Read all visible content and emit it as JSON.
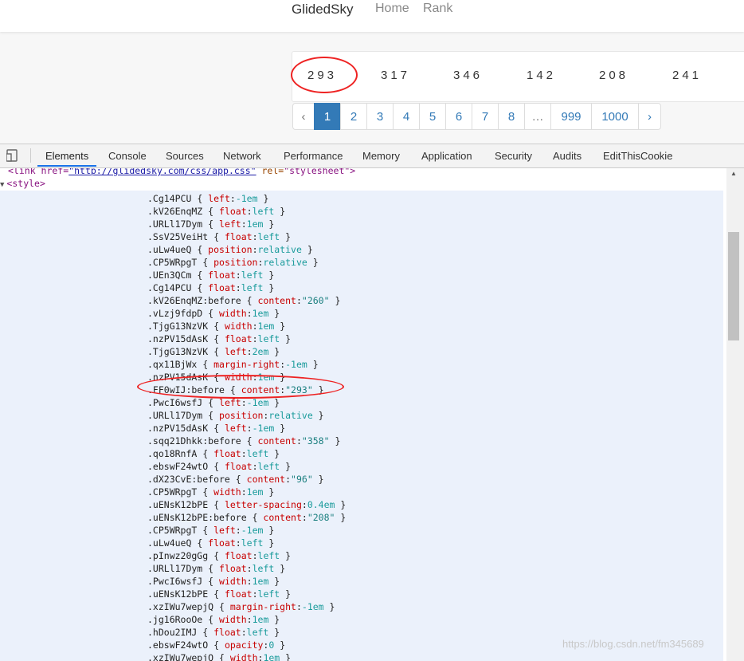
{
  "header": {
    "brand": "GlidedSky",
    "nav": [
      "Home",
      "Rank"
    ]
  },
  "numbers": [
    "293",
    "317",
    "346",
    "142",
    "208",
    "241"
  ],
  "pagination": [
    "‹",
    "1",
    "2",
    "3",
    "4",
    "5",
    "6",
    "7",
    "8",
    "…",
    "999",
    "1000",
    "›"
  ],
  "pagination_active": "1",
  "devtools": {
    "tabs": [
      "Elements",
      "Console",
      "Sources",
      "Network",
      "Performance",
      "Memory",
      "Application",
      "Security",
      "Audits",
      "EditThisCookie"
    ],
    "active_tab": "Elements",
    "link_line": {
      "tag_open": "<link href=",
      "href": "\"http://glidedsky.com/css/app.css\"",
      "rel_attr": " rel=",
      "rel_val": "\"stylesheet\"",
      "tag_close": ">"
    },
    "style_tag": "<style>",
    "rules": [
      {
        "sel": ".Cg14PCU",
        "prop": "left",
        "val": "-1em"
      },
      {
        "sel": ".kV26EnqMZ",
        "prop": "float",
        "val": "left"
      },
      {
        "sel": ".URLl17Dym",
        "prop": "left",
        "val": "1em"
      },
      {
        "sel": ".SsV25VeiHt",
        "prop": "float",
        "val": "left"
      },
      {
        "sel": ".uLw4ueQ",
        "prop": "position",
        "val": "relative"
      },
      {
        "sel": ".CP5WRpgT",
        "prop": "position",
        "val": "relative"
      },
      {
        "sel": ".UEn3QCm",
        "prop": "float",
        "val": "left"
      },
      {
        "sel": ".Cg14PCU",
        "prop": "float",
        "val": "left"
      },
      {
        "sel": ".kV26EnqMZ:before",
        "prop": "content",
        "val": "\"260\""
      },
      {
        "sel": ".vLzj9fdpD",
        "prop": "width",
        "val": "1em"
      },
      {
        "sel": ".TjgG13NzVK",
        "prop": "width",
        "val": "1em"
      },
      {
        "sel": ".nzPV15dAsK",
        "prop": "float",
        "val": "left"
      },
      {
        "sel": ".TjgG13NzVK",
        "prop": "left",
        "val": "2em"
      },
      {
        "sel": ".qx11BjWx",
        "prop": "margin-right",
        "val": "-1em"
      },
      {
        "sel": ".nzPV15dAsK",
        "prop": "width",
        "val": "1em"
      },
      {
        "sel": ".FF0wIJ:before",
        "prop": "content",
        "val": "\"293\""
      },
      {
        "sel": ".PwcI6wsfJ",
        "prop": "left",
        "val": "-1em"
      },
      {
        "sel": ".URLl17Dym",
        "prop": "position",
        "val": "relative"
      },
      {
        "sel": ".nzPV15dAsK",
        "prop": "left",
        "val": "-1em"
      },
      {
        "sel": ".sqq21Dhkk:before",
        "prop": "content",
        "val": "\"358\""
      },
      {
        "sel": ".qo18RnfA",
        "prop": "float",
        "val": "left"
      },
      {
        "sel": ".ebswF24wtO",
        "prop": "float",
        "val": "left"
      },
      {
        "sel": ".dX23CvE:before",
        "prop": "content",
        "val": "\"96\""
      },
      {
        "sel": ".CP5WRpgT",
        "prop": "width",
        "val": "1em"
      },
      {
        "sel": ".uENsK12bPE",
        "prop": "letter-spacing",
        "val": "0.4em"
      },
      {
        "sel": ".uENsK12bPE:before",
        "prop": "content",
        "val": "\"208\""
      },
      {
        "sel": ".CP5WRpgT",
        "prop": "left",
        "val": "-1em"
      },
      {
        "sel": ".uLw4ueQ",
        "prop": "float",
        "val": "left"
      },
      {
        "sel": ".pInwz20gGg",
        "prop": "float",
        "val": "left"
      },
      {
        "sel": ".URLl17Dym",
        "prop": "float",
        "val": "left"
      },
      {
        "sel": ".PwcI6wsfJ",
        "prop": "width",
        "val": "1em"
      },
      {
        "sel": ".uENsK12bPE",
        "prop": "float",
        "val": "left"
      },
      {
        "sel": ".xzIWu7wepjQ",
        "prop": "margin-right",
        "val": "-1em"
      },
      {
        "sel": ".jg16RooOe",
        "prop": "width",
        "val": "1em"
      },
      {
        "sel": ".hDou2IMJ",
        "prop": "float",
        "val": "left"
      },
      {
        "sel": ".ebswF24wtO",
        "prop": "opacity",
        "val": "0"
      },
      {
        "sel": ".xzIWu7wepjQ",
        "prop": "width",
        "val": "1em"
      }
    ]
  },
  "watermark": "https://blog.csdn.net/fm345689",
  "colors": {
    "accent": "#337ab7",
    "annotation": "#ee2222",
    "css_property": "#c80000",
    "css_value": "#1a9b9b"
  }
}
